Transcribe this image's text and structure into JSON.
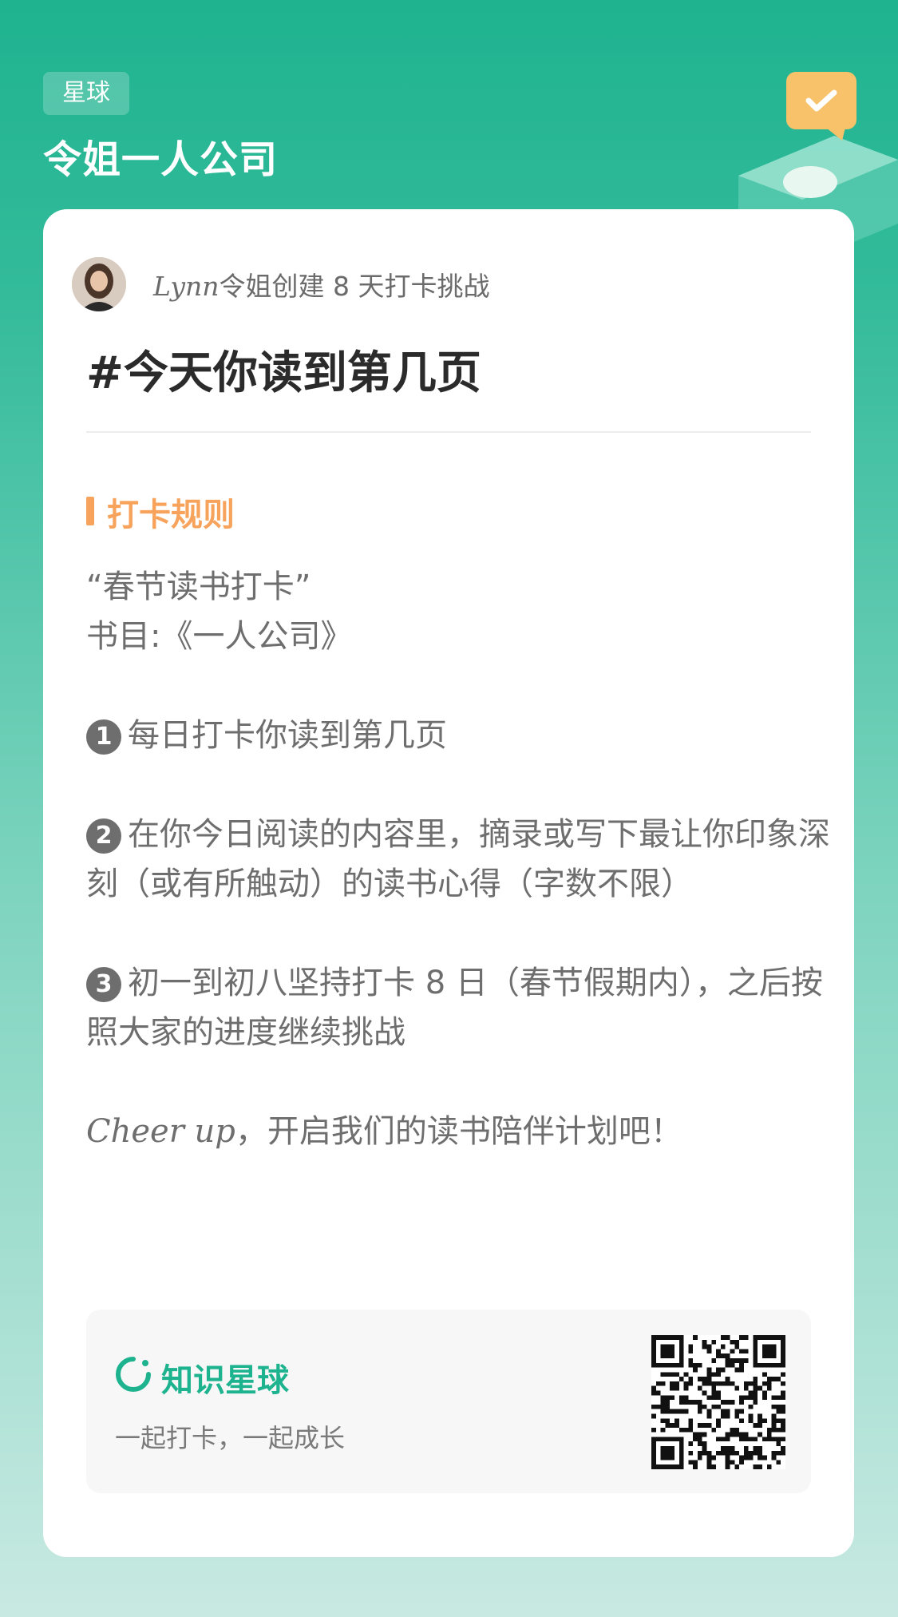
{
  "header": {
    "tag": "星球",
    "group_name": "令姐一人公司"
  },
  "card": {
    "creator_name": "Lynn",
    "creator_suffix": "令姐创建 8 天打卡挑战",
    "title": "#今天你读到第几页",
    "section_title": "打卡规则",
    "rules": {
      "line1": "“春节读书打卡”",
      "line2": "书目:《一人公司》",
      "item1_num": "1",
      "item1": "每日打卡你读到第几页",
      "item2_num": "2",
      "item2": "在你今日阅读的内容里，摘录或写下最让你印象深刻（或有所触动）的读书心得（字数不限）",
      "item3_num": "3",
      "item3": "初一到初八坚持打卡 8 日（春节假期内），之后按照大家的进度继续挑战",
      "cheer_en": "Cheer up",
      "cheer_cn": "，开启我们的读书陪伴计划吧！"
    }
  },
  "footer": {
    "brand": "知识星球",
    "slogan": "一起打卡，一起成长"
  },
  "colors": {
    "accent": "#1eb38f",
    "section": "#f7a35c"
  }
}
